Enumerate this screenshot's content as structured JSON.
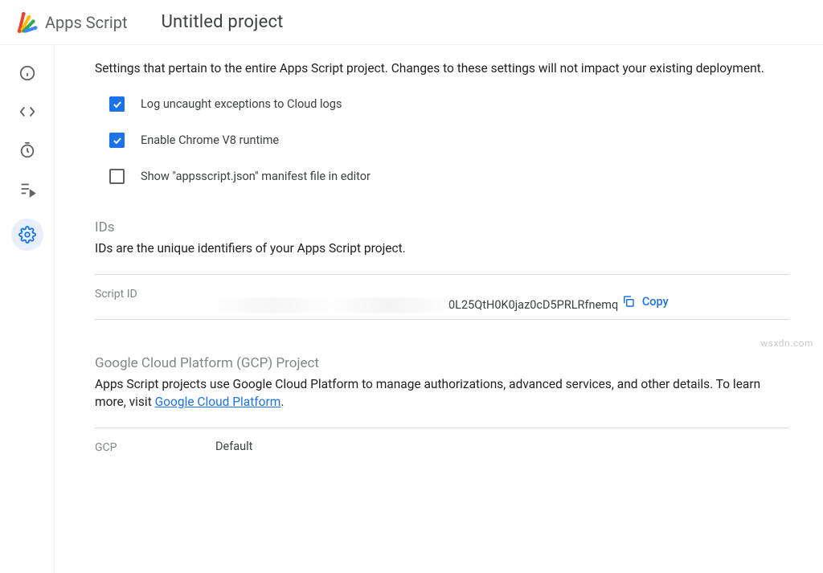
{
  "header": {
    "logo_text": "Apps Script",
    "project_title": "Untitled project"
  },
  "settings": {
    "description": "Settings that pertain to the entire Apps Script project. Changes to these settings will not impact your existing deployment.",
    "checkboxes": {
      "log_exceptions": "Log uncaught exceptions to Cloud logs",
      "v8_runtime": "Enable Chrome V8 runtime",
      "manifest": "Show \"appsscript.json\" manifest file in editor"
    }
  },
  "ids": {
    "heading": "IDs",
    "description": "IDs are the unique identifiers of your Apps Script project.",
    "script_id_label": "Script ID",
    "script_id_visible": "0L25QtH0K0jaz0cD5PRLRfnemq",
    "copy_label": "Copy"
  },
  "gcp": {
    "heading": "Google Cloud Platform (GCP) Project",
    "description_pre": "Apps Script projects use Google Cloud Platform to manage authorizations, advanced services, and other details. To learn more, visit ",
    "description_link": "Google Cloud Platform",
    "description_post": ".",
    "label": "GCP",
    "value": "Default"
  },
  "watermark": "wsxdn.com"
}
